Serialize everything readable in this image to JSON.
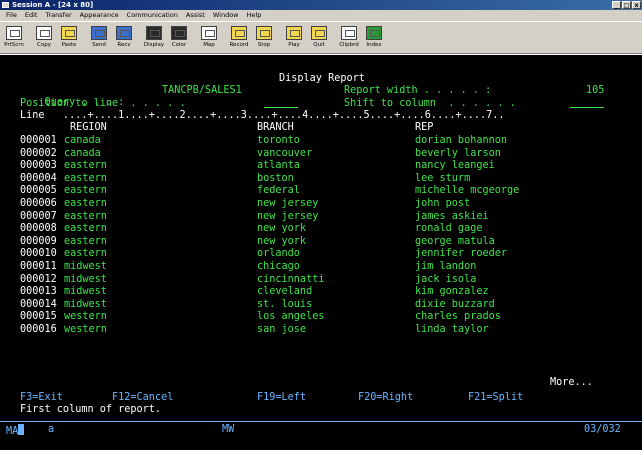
{
  "window": {
    "title": "Session A - [24 x 80]",
    "controls": [
      "_",
      "□",
      "x"
    ]
  },
  "menu": [
    "File",
    "Edit",
    "Transfer",
    "Appearance",
    "Communication",
    "Assist",
    "Window",
    "Help"
  ],
  "toolbar": [
    {
      "label": "PrtScrn",
      "icon": "print-screen-icon"
    },
    {
      "label": "Copy",
      "icon": "copy-icon"
    },
    {
      "label": "Paste",
      "icon": "paste-icon"
    },
    {
      "label": "Send",
      "icon": "send-icon"
    },
    {
      "label": "Recv",
      "icon": "receive-icon"
    },
    {
      "label": "Display",
      "icon": "display-icon"
    },
    {
      "label": "Color",
      "icon": "color-icon"
    },
    {
      "label": "Map",
      "icon": "map-icon"
    },
    {
      "label": "Record",
      "icon": "record-icon"
    },
    {
      "label": "Stop",
      "icon": "stop-icon"
    },
    {
      "label": "Play",
      "icon": "play-icon"
    },
    {
      "label": "Quit",
      "icon": "quit-icon"
    },
    {
      "label": "Clipbrd",
      "icon": "clipboard-icon"
    },
    {
      "label": "Index",
      "icon": "index-icon"
    }
  ],
  "screen": {
    "heading": "Display Report",
    "query_label": "Query . . . :",
    "query_value": "TANCPB/SALES1",
    "report_width_label": "Report width . . . . . :",
    "report_width_value": "105",
    "position_label": "Position to line  . . . . .",
    "shift_label": "Shift to column  . . . . . .",
    "ruler": "Line   ....+....1....+....2....+....3....+....4....+....5....+....6....+....7..",
    "col_region": "REGION",
    "col_branch": "BRANCH",
    "col_rep": "REP",
    "rows": [
      {
        "line": "000001",
        "region": "canada",
        "branch": "toronto",
        "rep": "dorian bohannon"
      },
      {
        "line": "000002",
        "region": "canada",
        "branch": "vancouver",
        "rep": "beverly larson"
      },
      {
        "line": "000003",
        "region": "eastern",
        "branch": "atlanta",
        "rep": "nancy leangei"
      },
      {
        "line": "000004",
        "region": "eastern",
        "branch": "boston",
        "rep": "lee sturm"
      },
      {
        "line": "000005",
        "region": "eastern",
        "branch": "federal",
        "rep": "michelle mcgeorge"
      },
      {
        "line": "000006",
        "region": "eastern",
        "branch": "new jersey",
        "rep": "john post"
      },
      {
        "line": "000007",
        "region": "eastern",
        "branch": "new jersey",
        "rep": "james askiei"
      },
      {
        "line": "000008",
        "region": "eastern",
        "branch": "new york",
        "rep": "ronald gage"
      },
      {
        "line": "000009",
        "region": "eastern",
        "branch": "new york",
        "rep": "george matula"
      },
      {
        "line": "000010",
        "region": "eastern",
        "branch": "orlando",
        "rep": "jennifer roeder"
      },
      {
        "line": "000011",
        "region": "midwest",
        "branch": "chicago",
        "rep": "jim landon"
      },
      {
        "line": "000012",
        "region": "midwest",
        "branch": "cincinnatti",
        "rep": "jack isola"
      },
      {
        "line": "000013",
        "region": "midwest",
        "branch": "cleveland",
        "rep": "kim gonzalez"
      },
      {
        "line": "000014",
        "region": "midwest",
        "branch": "st. louis",
        "rep": "dixie buzzard"
      },
      {
        "line": "000015",
        "region": "western",
        "branch": "los angeles",
        "rep": "charles prados"
      },
      {
        "line": "000016",
        "region": "western",
        "branch": "san jose",
        "rep": "linda taylor"
      }
    ],
    "more": "More...",
    "fkeys": {
      "f3": "F3=Exit",
      "f12": "F12=Cancel",
      "f19": "F19=Left",
      "f20": "F20=Right",
      "f21": "F21=Split"
    },
    "message": "First column of report.",
    "oia": {
      "mode": "MA",
      "session": "a",
      "mw": "MW",
      "cursor_pos": "03/032"
    }
  },
  "colors": {
    "background": "#000000",
    "field_text": "#3fe34a",
    "protected_text": "#ffffff",
    "info": "#6ab4ff"
  }
}
